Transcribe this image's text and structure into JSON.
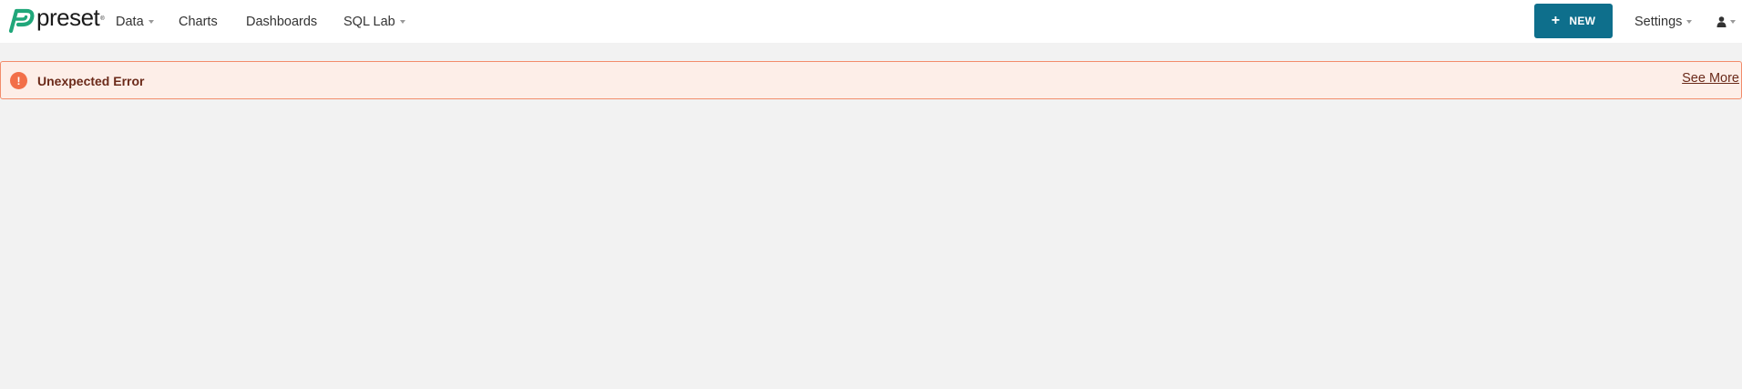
{
  "navbar": {
    "brand": {
      "text": "preset",
      "trademark": "®",
      "color": "#20a77a"
    },
    "items": [
      {
        "label": "Data",
        "has_dropdown": true
      },
      {
        "label": "Charts",
        "has_dropdown": false
      },
      {
        "label": "Dashboards",
        "has_dropdown": false
      },
      {
        "label": "SQL Lab",
        "has_dropdown": true
      }
    ],
    "new_button": {
      "label": "NEW",
      "icon": "plus-icon",
      "color": "#0e6f8c"
    },
    "settings": {
      "label": "Settings",
      "has_dropdown": true
    },
    "user_menu": {
      "icon": "user-icon",
      "has_dropdown": true
    }
  },
  "alert": {
    "type": "error",
    "icon": "exclamation-icon",
    "message": "Unexpected Error",
    "action_label": "See More",
    "colors": {
      "background": "#fdeee8",
      "border": "#f28c6b",
      "icon": "#f26f49",
      "text": "#6b2a1a"
    }
  }
}
